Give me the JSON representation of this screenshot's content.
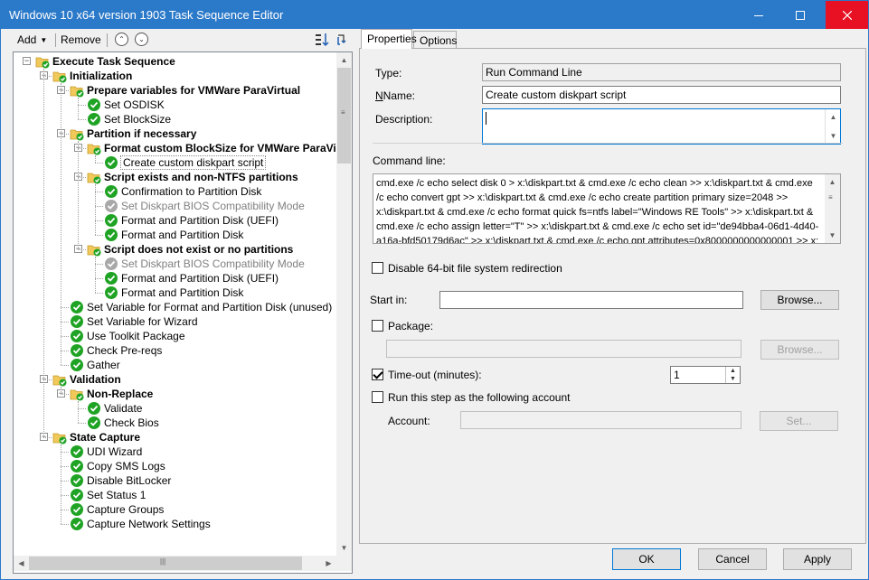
{
  "window": {
    "title": "Windows 10 x64 version 1903 Task Sequence Editor"
  },
  "toolbar": {
    "add_label": "Add",
    "remove_label": "Remove"
  },
  "tree": {
    "items": [
      {
        "label": "Execute Task Sequence",
        "level": 0,
        "kind": "group",
        "expanded": true
      },
      {
        "label": "Initialization",
        "level": 1,
        "kind": "group",
        "expanded": true
      },
      {
        "label": "Prepare variables for VMWare ParaVirtual",
        "level": 2,
        "kind": "group",
        "expanded": true
      },
      {
        "label": "Set OSDISK",
        "level": 3,
        "kind": "step"
      },
      {
        "label": "Set BlockSize",
        "level": 3,
        "kind": "step"
      },
      {
        "label": "Partition if necessary",
        "level": 2,
        "kind": "group",
        "expanded": true
      },
      {
        "label": "Format custom BlockSize for VMWare ParaVi",
        "level": 3,
        "kind": "group",
        "expanded": true
      },
      {
        "label": "Create custom diskpart script",
        "level": 4,
        "kind": "step",
        "selected": true
      },
      {
        "label": "Script exists and non-NTFS partitions",
        "level": 3,
        "kind": "group",
        "expanded": true
      },
      {
        "label": "Confirmation to Partition Disk",
        "level": 4,
        "kind": "step"
      },
      {
        "label": "Set Diskpart BIOS Compatibility Mode",
        "level": 4,
        "kind": "step",
        "disabled": true
      },
      {
        "label": "Format and Partition Disk (UEFI)",
        "level": 4,
        "kind": "step"
      },
      {
        "label": "Format and Partition Disk",
        "level": 4,
        "kind": "step"
      },
      {
        "label": "Script does not exist or no partitions",
        "level": 3,
        "kind": "group",
        "expanded": true
      },
      {
        "label": "Set Diskpart BIOS Compatibility Mode",
        "level": 4,
        "kind": "step",
        "disabled": true
      },
      {
        "label": "Format and Partition Disk (UEFI)",
        "level": 4,
        "kind": "step"
      },
      {
        "label": "Format and Partition Disk",
        "level": 4,
        "kind": "step"
      },
      {
        "label": "Set Variable for Format and Partition Disk (unused)",
        "level": 2,
        "kind": "step"
      },
      {
        "label": "Set Variable for Wizard",
        "level": 2,
        "kind": "step"
      },
      {
        "label": "Use Toolkit Package",
        "level": 2,
        "kind": "step"
      },
      {
        "label": "Check Pre-reqs",
        "level": 2,
        "kind": "step"
      },
      {
        "label": "Gather",
        "level": 2,
        "kind": "step"
      },
      {
        "label": "Validation",
        "level": 1,
        "kind": "group",
        "expanded": true
      },
      {
        "label": "Non-Replace",
        "level": 2,
        "kind": "group",
        "expanded": true
      },
      {
        "label": "Validate",
        "level": 3,
        "kind": "step"
      },
      {
        "label": "Check Bios",
        "level": 3,
        "kind": "step"
      },
      {
        "label": "State Capture",
        "level": 1,
        "kind": "group",
        "expanded": true
      },
      {
        "label": "UDI Wizard",
        "level": 2,
        "kind": "step"
      },
      {
        "label": "Copy SMS Logs",
        "level": 2,
        "kind": "step"
      },
      {
        "label": "Disable BitLocker",
        "level": 2,
        "kind": "step"
      },
      {
        "label": "Set Status 1",
        "level": 2,
        "kind": "step"
      },
      {
        "label": "Capture Groups",
        "level": 2,
        "kind": "step"
      },
      {
        "label": "Capture Network Settings",
        "level": 2,
        "kind": "step"
      }
    ]
  },
  "tabs": {
    "properties": "Properties",
    "options": "Options"
  },
  "properties": {
    "type_label": "Type:",
    "type_value": "Run Command Line",
    "name_label": "Name:",
    "name_value": "Create custom diskpart script",
    "description_label": "Description:",
    "description_value": "",
    "command_line_label": "Command line:",
    "command_line_value": "cmd.exe /c echo select disk 0 > x:\\diskpart.txt & cmd.exe /c echo clean >> x:\\diskpart.txt & cmd.exe /c echo convert gpt >> x:\\diskpart.txt & cmd.exe /c echo create partition primary size=2048 >> x:\\diskpart.txt & cmd.exe /c echo format quick fs=ntfs label=\"Windows RE Tools\" >> x:\\diskpart.txt & cmd.exe /c echo assign letter=\"T\" >> x:\\diskpart.txt & cmd.exe /c echo set id=\"de94bba4-06d1-4d40-a16a-bfd50179d6ac\" >> x:\\diskpart.txt & cmd.exe /c echo gpt attributes=0x8000000000000001 >> x:",
    "disable_redirection_label": "Disable 64-bit file system redirection",
    "start_in_label": "Start in:",
    "start_in_value": "",
    "browse_label": "Browse...",
    "package_label": "Package:",
    "package_value": "",
    "browse2_label": "Browse...",
    "timeout_label": "Time-out (minutes):",
    "timeout_value": "1",
    "run_as_label": "Run this step as the following account",
    "account_label": "Account:",
    "account_value": "",
    "set_label": "Set..."
  },
  "buttons": {
    "ok": "OK",
    "cancel": "Cancel",
    "apply": "Apply"
  },
  "colors": {
    "titlebar": "#2b79c9",
    "close": "#e81123",
    "check_green": "#1fa324"
  }
}
